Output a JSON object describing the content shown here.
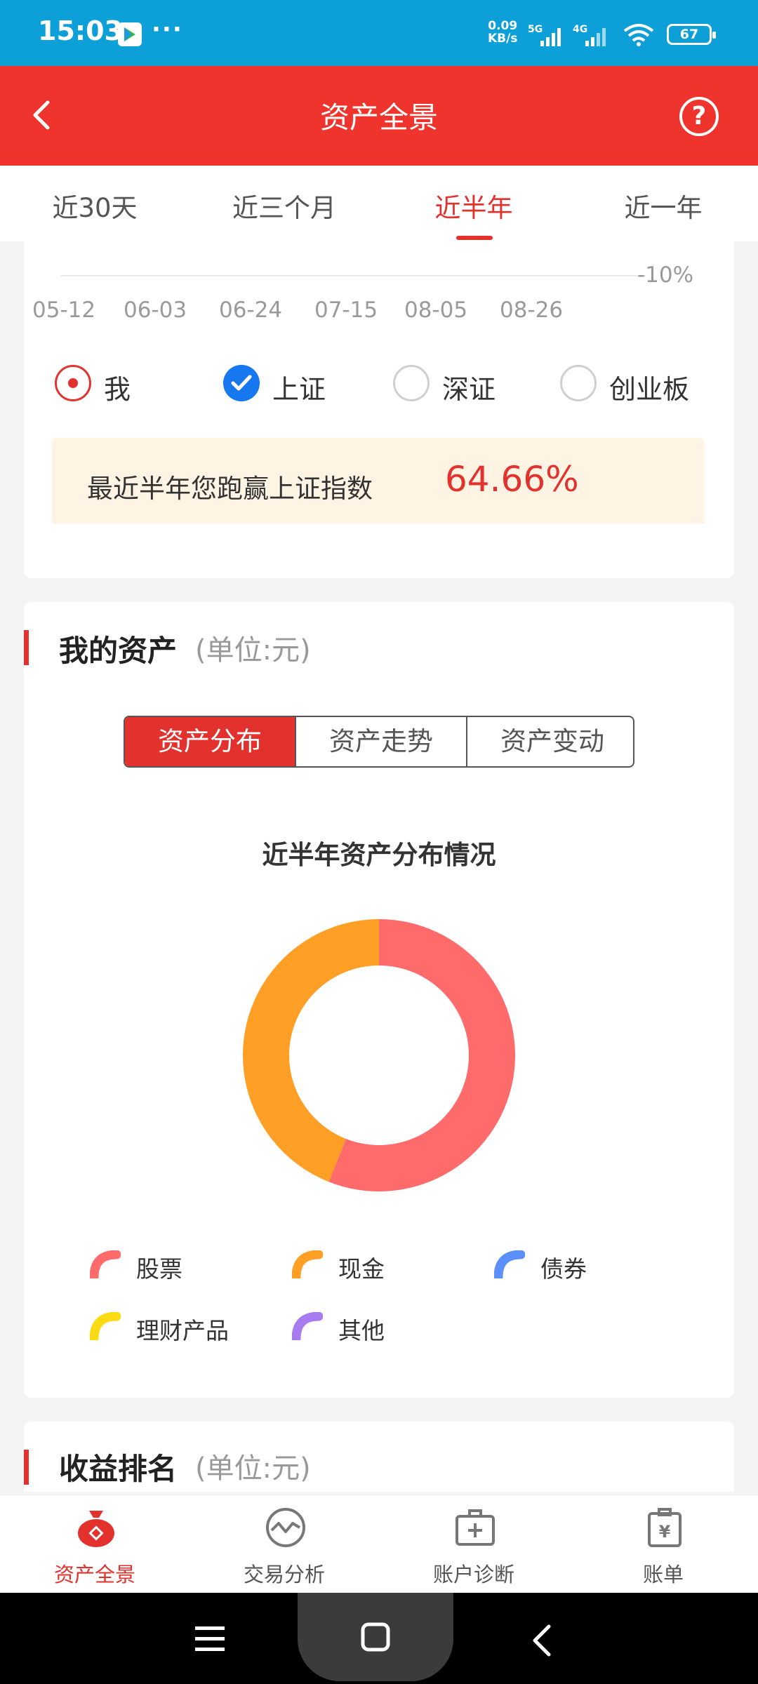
{
  "status_bar": {
    "time": "15:03",
    "more": "···",
    "net_speed": "0.09",
    "net_unit": "KB/s",
    "net_5g": "5G",
    "net_4g": "4G",
    "battery": "67"
  },
  "header": {
    "title": "资产全景",
    "help": "?"
  },
  "period_tabs": {
    "items": [
      "近30天",
      "近三个月",
      "近半年",
      "近一年"
    ],
    "active": "近半年"
  },
  "trend_chart": {
    "y_tick": "-10%",
    "x_ticks": [
      "05-12",
      "06-03",
      "06-24",
      "07-15",
      "08-05",
      "08-26"
    ]
  },
  "compare": {
    "options": [
      "我",
      "上证",
      "深证",
      "创业板"
    ],
    "summary_text": "最近半年您跑赢上证指数",
    "summary_value": "64.66%"
  },
  "assets": {
    "title": "我的资产",
    "unit": "(单位:元)",
    "segments": [
      "资产分布",
      "资产走势",
      "资产变动"
    ],
    "active_segment": "资产分布"
  },
  "chart_data": {
    "type": "pie",
    "title": "近半年资产分布情况",
    "categories": [
      "股票",
      "现金",
      "债券",
      "理财产品",
      "其他"
    ],
    "values": [
      56,
      44,
      0,
      0,
      0
    ],
    "colors": [
      "#ff6b6b",
      "#ff9f25",
      "#5b8ff9",
      "#fadb14",
      "#a87cf0"
    ],
    "donut": true
  },
  "ranking": {
    "title": "收益排名",
    "unit": "(单位:元)"
  },
  "bottom_nav": {
    "items": [
      "资产全景",
      "交易分析",
      "账户诊断",
      "账单"
    ],
    "active": "资产全景",
    "icons": [
      "money-bag-icon",
      "trend-circle-icon",
      "medical-kit-icon",
      "bill-yen-icon"
    ]
  },
  "colors": {
    "accent": "#e3322d",
    "status_bar": "#0da0d8",
    "checkbox": "#1677ef",
    "banner_bg": "#fff4e4"
  }
}
